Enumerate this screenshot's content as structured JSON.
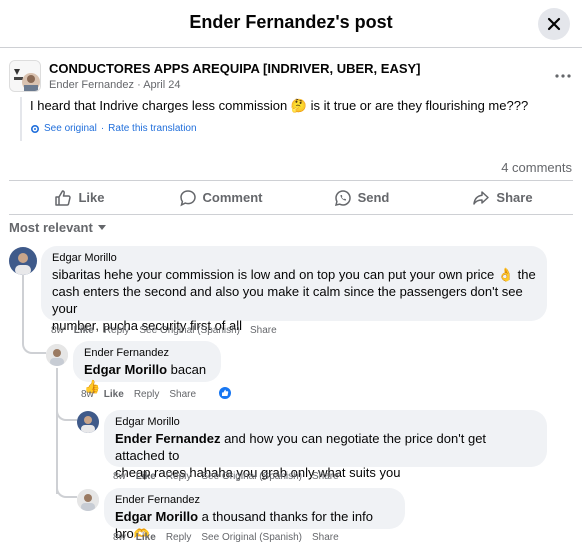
{
  "header": {
    "title": "Ender Fernandez's post"
  },
  "post": {
    "group_name": "CONDUCTORES APPS AREQUIPA [INDRIVER, UBER, EASY]",
    "author": "Ender Fernandez",
    "date": "April 24",
    "separator": "·",
    "text_before": "I heard that Indrive charges less commission",
    "text_emoji": "🤔",
    "text_after": "is it true or are they flourishing me???",
    "see_original": "See original",
    "dot": "·",
    "rate_translation": "Rate this translation",
    "comment_count": "4 comments"
  },
  "actions": {
    "like": "Like",
    "comment": "Comment",
    "send": "Send",
    "share": "Share"
  },
  "sort": {
    "label": "Most relevant"
  },
  "comments": [
    {
      "name": "Edgar Morillo",
      "line1": "sibaritas hehe your commission is low and on top you can put your own price 👌 the",
      "line2": "cash enters the second and also you make it calm since the passengers don't see your",
      "line3": "number, pucha security first of all",
      "time": "8w",
      "like": "Like",
      "reply": "Reply",
      "see_original": "See Original (Spanish)",
      "share": "Share"
    },
    {
      "name": "Ender Fernandez",
      "mention": "Edgar Morillo",
      "text": " bacan 👍",
      "time": "8w",
      "like": "Like",
      "reply": "Reply",
      "share": "Share"
    },
    {
      "name": "Edgar Morillo",
      "mention": "Ender Fernandez",
      "line1": " and how you can negotiate the price don't get attached to",
      "line2": "cheap races hahaha you grab only what suits you",
      "time": "8w",
      "like": "Like",
      "reply": "Reply",
      "see_original": "See Original (Spanish)",
      "share": "Share"
    },
    {
      "name": "Ender Fernandez",
      "mention": "Edgar Morillo",
      "text": " a thousand thanks for the info bro🫶",
      "time": "8w",
      "like": "Like",
      "reply": "Reply",
      "see_original": "See Original (Spanish)",
      "share": "Share"
    }
  ]
}
